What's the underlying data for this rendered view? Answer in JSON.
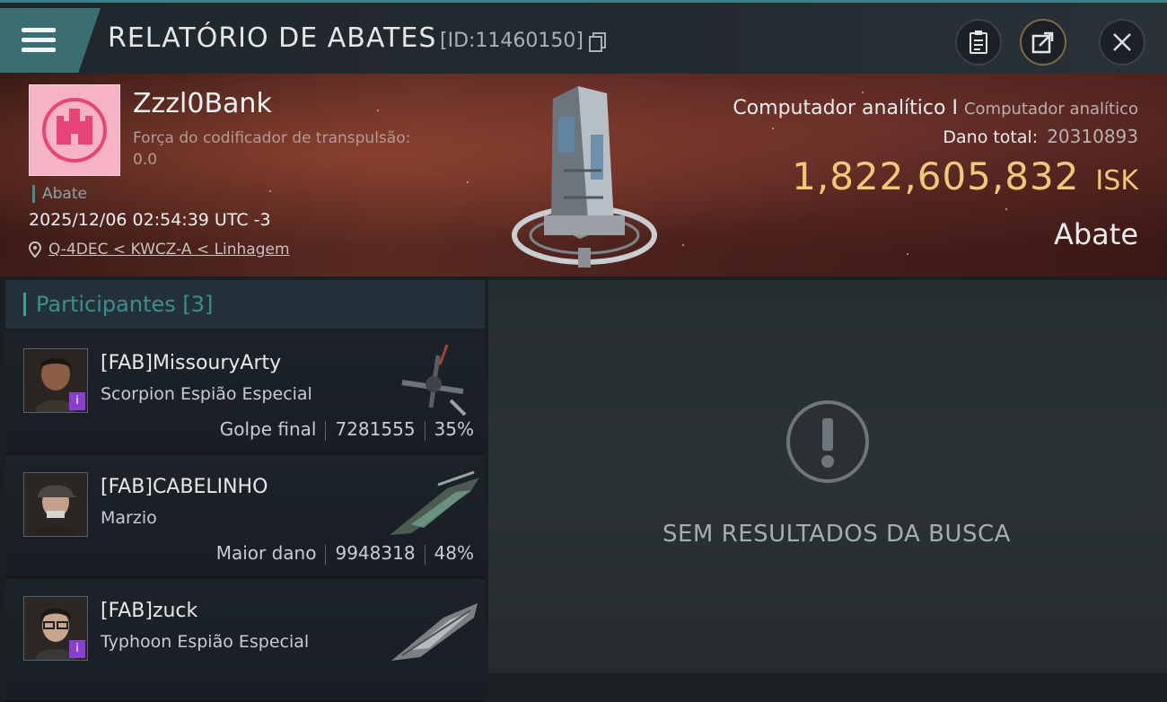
{
  "header": {
    "title": "RELATÓRIO DE ABATES",
    "id_text": "[ID:11460150]"
  },
  "victim": {
    "name": "Zzzl0Bank",
    "force_label": "Força do codificador de transpulsão:",
    "force_value": "0.0",
    "tag": "Abate",
    "datetime": "2025/12/06 02:54:39 UTC -3",
    "location": "Q-4DEC < KWCZ-A < Linhagem"
  },
  "kill": {
    "ship_name": "Computador analítico I",
    "ship_type": "Computador analítico",
    "damage_label": "Dano total:",
    "damage_value": "20310893",
    "isk_value": "1,822,605,832",
    "isk_unit": "ISK",
    "result": "Abate"
  },
  "participants": {
    "label": "Participantes",
    "count": "[3]",
    "items": [
      {
        "name": "[FAB]MissouryArty",
        "ship": "Scorpion Espião Especial",
        "role": "Golpe final",
        "damage": "7281555",
        "percent": "35%"
      },
      {
        "name": "[FAB]CABELINHO",
        "ship": "Marzio",
        "role": "Maior dano",
        "damage": "9948318",
        "percent": "48%"
      },
      {
        "name": "[FAB]zuck",
        "ship": "Typhoon Espião Especial"
      }
    ]
  },
  "empty_state": {
    "message": "SEM RESULTADOS DA BUSCA",
    "icon": "exclamation-icon"
  },
  "icons": {
    "menu": "hamburger-icon",
    "copy": "copy-icon",
    "clipboard": "clipboard-icon",
    "share": "share-icon",
    "close": "close-icon",
    "location": "map-pin-icon"
  },
  "colors": {
    "accent_teal": "#3c8f8c",
    "isk_gold": "#f0c879",
    "banner_red": "#5a2a22",
    "corp_pink": "#f6b3c6",
    "badge_purple": "#8a3fd0"
  }
}
